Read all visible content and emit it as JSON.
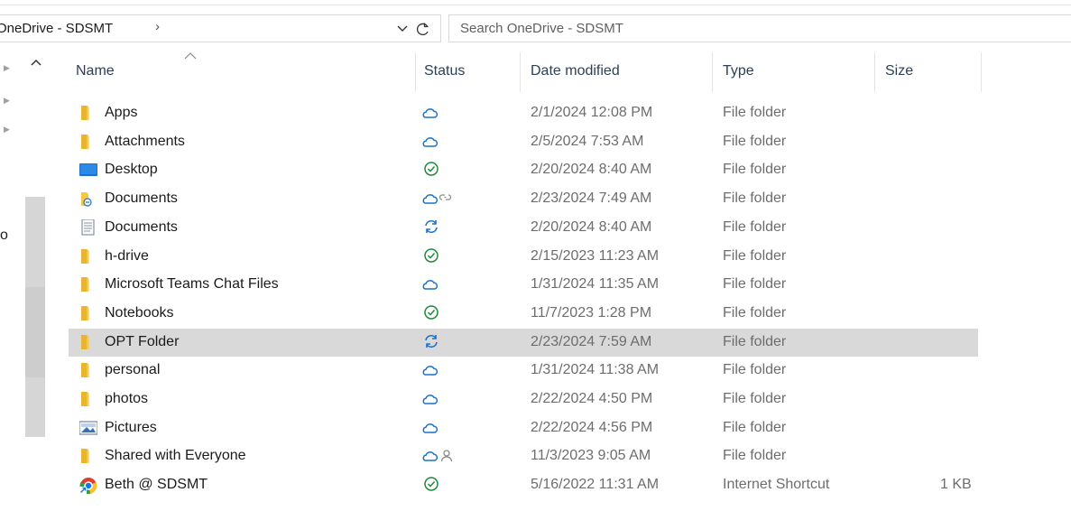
{
  "address": {
    "path": "OneDrive - SDSMT",
    "separator": "›"
  },
  "search": {
    "placeholder": "Search OneDrive - SDSMT"
  },
  "navpane": {
    "partial_label": "o"
  },
  "columns": {
    "name": "Name",
    "status": "Status",
    "date": "Date modified",
    "type": "Type",
    "size": "Size"
  },
  "colors": {
    "cloud": "#1a73c9",
    "synced": "#1f8a3a",
    "folder": "#f7c845",
    "selected": "#d9d9d9"
  },
  "files": [
    {
      "name": "Apps",
      "icon": "folder-icon",
      "status": "cloud",
      "date": "2/1/2024 12:08 PM",
      "type": "File folder",
      "size": ""
    },
    {
      "name": "Attachments",
      "icon": "folder-icon",
      "status": "cloud",
      "date": "2/5/2024 7:53 AM",
      "type": "File folder",
      "size": ""
    },
    {
      "name": "Desktop",
      "icon": "desktop-folder-icon",
      "status": "synced",
      "date": "2/20/2024 8:40 AM",
      "type": "File folder",
      "size": ""
    },
    {
      "name": "Documents",
      "icon": "shared-folder-icon",
      "status": "cloud-link",
      "date": "2/23/2024 7:49 AM",
      "type": "File folder",
      "size": ""
    },
    {
      "name": "Documents",
      "icon": "documents-folder-icon",
      "status": "syncing",
      "date": "2/20/2024 8:40 AM",
      "type": "File folder",
      "size": ""
    },
    {
      "name": "h-drive",
      "icon": "folder-icon",
      "status": "synced",
      "date": "2/15/2023 11:23 AM",
      "type": "File folder",
      "size": ""
    },
    {
      "name": "Microsoft Teams Chat Files",
      "icon": "folder-icon",
      "status": "cloud",
      "date": "1/31/2024 11:35 AM",
      "type": "File folder",
      "size": ""
    },
    {
      "name": "Notebooks",
      "icon": "folder-icon",
      "status": "synced",
      "date": "11/7/2023 1:28 PM",
      "type": "File folder",
      "size": ""
    },
    {
      "name": "OPT Folder",
      "icon": "folder-icon",
      "status": "syncing",
      "date": "2/23/2024 7:59 AM",
      "type": "File folder",
      "size": "",
      "selected": true
    },
    {
      "name": "personal",
      "icon": "folder-icon",
      "status": "cloud",
      "date": "1/31/2024 11:38 AM",
      "type": "File folder",
      "size": ""
    },
    {
      "name": "photos",
      "icon": "folder-icon",
      "status": "cloud",
      "date": "2/22/2024 4:50 PM",
      "type": "File folder",
      "size": ""
    },
    {
      "name": "Pictures",
      "icon": "pictures-folder-icon",
      "status": "cloud",
      "date": "2/22/2024 4:56 PM",
      "type": "File folder",
      "size": ""
    },
    {
      "name": "Shared with Everyone",
      "icon": "folder-icon",
      "status": "cloud-shared",
      "date": "11/3/2023 9:05 AM",
      "type": "File folder",
      "size": ""
    },
    {
      "name": "Beth @ SDSMT",
      "icon": "chrome-shortcut-icon",
      "status": "synced",
      "date": "5/16/2022 11:31 AM",
      "type": "Internet Shortcut",
      "size": "1 KB"
    }
  ]
}
